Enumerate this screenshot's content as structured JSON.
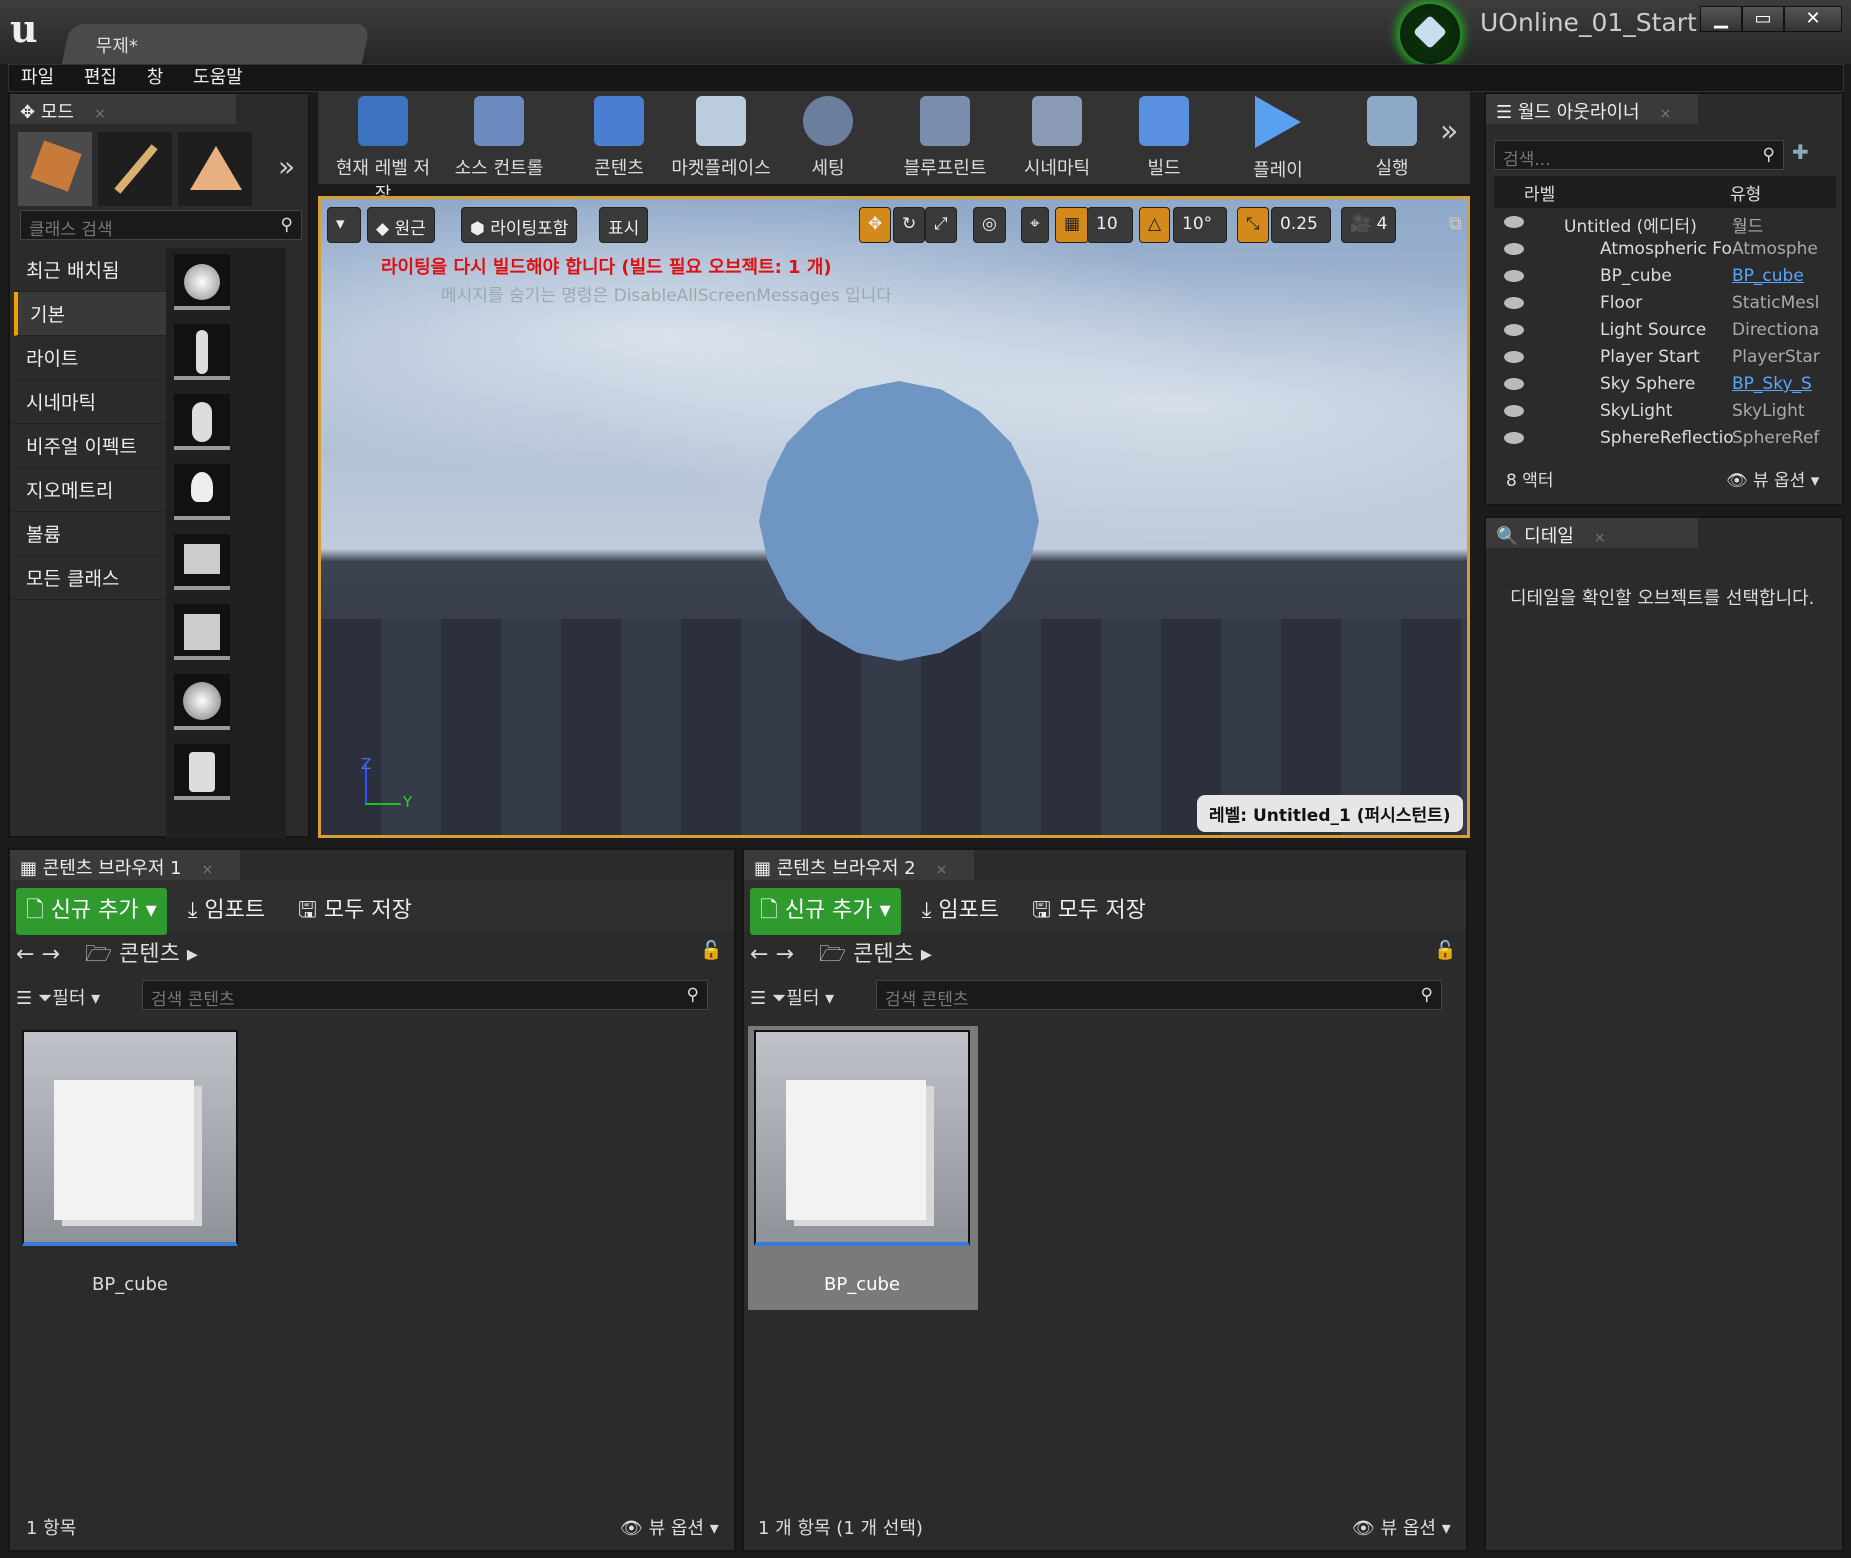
{
  "title": {
    "tab": "무제*",
    "project": "UOnline_01_Start",
    "min": "▁",
    "max": "▭",
    "close": "✕"
  },
  "menu": [
    "파일",
    "편집",
    "창",
    "도움말"
  ],
  "modes": {
    "tab": "모드",
    "search_placeholder": "클래스 검색",
    "categories": [
      "최근 배치됨",
      "기본",
      "라이트",
      "시네마틱",
      "비주얼 이펙트",
      "지오메트리",
      "볼륨",
      "모든 클래스"
    ]
  },
  "toolbar": {
    "items": [
      "현재 레벨 저장",
      "소스 컨트롤",
      "콘텐츠",
      "마켓플레이스",
      "세팅",
      "블루프린트",
      "시네마틱",
      "빌드",
      "플레이",
      "실행"
    ]
  },
  "viewport": {
    "perspective": "원근",
    "lit": "라이팅포함",
    "show": "표시",
    "grid": "10",
    "angle": "10°",
    "scale": "0.25",
    "camspeed": "4",
    "msg_error": "라이팅을 다시 빌드해야 합니다 (빌드 필요 오브젝트: 1 개)",
    "msg_hint": "메시지를 숨기는 명령은 DisableAllScreenMessages 입니다",
    "level": "레벨:  Untitled_1 (퍼시스턴트)",
    "axis_z": "Z",
    "axis_y": "Y"
  },
  "outliner": {
    "tab": "월드 아웃라이너",
    "search_placeholder": "검색...",
    "col_label": "라벨",
    "col_type": "유형",
    "rows": [
      {
        "name": "Untitled (에디터)",
        "type": "월드"
      },
      {
        "name": "Atmospheric Fo",
        "type": "Atmosphe"
      },
      {
        "name": "BP_cube",
        "type": "BP_cube"
      },
      {
        "name": "Floor",
        "type": "StaticMesl"
      },
      {
        "name": "Light Source",
        "type": "Directiona"
      },
      {
        "name": "Player Start",
        "type": "PlayerStar"
      },
      {
        "name": "Sky Sphere",
        "type": "BP_Sky_S"
      },
      {
        "name": "SkyLight",
        "type": "SkyLight"
      },
      {
        "name": "SphereReflectio",
        "type": "SphereRef"
      }
    ],
    "count": "8 액터",
    "view_options": "뷰 옵션"
  },
  "details": {
    "tab": "디테일",
    "empty": "디테일을 확인할 오브젝트를 선택합니다."
  },
  "cb1": {
    "tab": "콘텐츠 브라우저 1",
    "add": "신규 추가",
    "import": "임포트",
    "save": "모두 저장",
    "path": "콘텐츠",
    "filter": "필터",
    "search_placeholder": "검색 콘텐츠",
    "asset": "BP_cube",
    "status": "1 항목",
    "view_options": "뷰 옵션"
  },
  "cb2": {
    "tab": "콘텐츠 브라우저 2",
    "add": "신규 추가",
    "import": "임포트",
    "save": "모두 저장",
    "path": "콘텐츠",
    "filter": "필터",
    "search_placeholder": "검색 콘텐츠",
    "asset": "BP_cube",
    "status": "1 개 항목 (1 개 선택)",
    "view_options": "뷰 옵션"
  }
}
